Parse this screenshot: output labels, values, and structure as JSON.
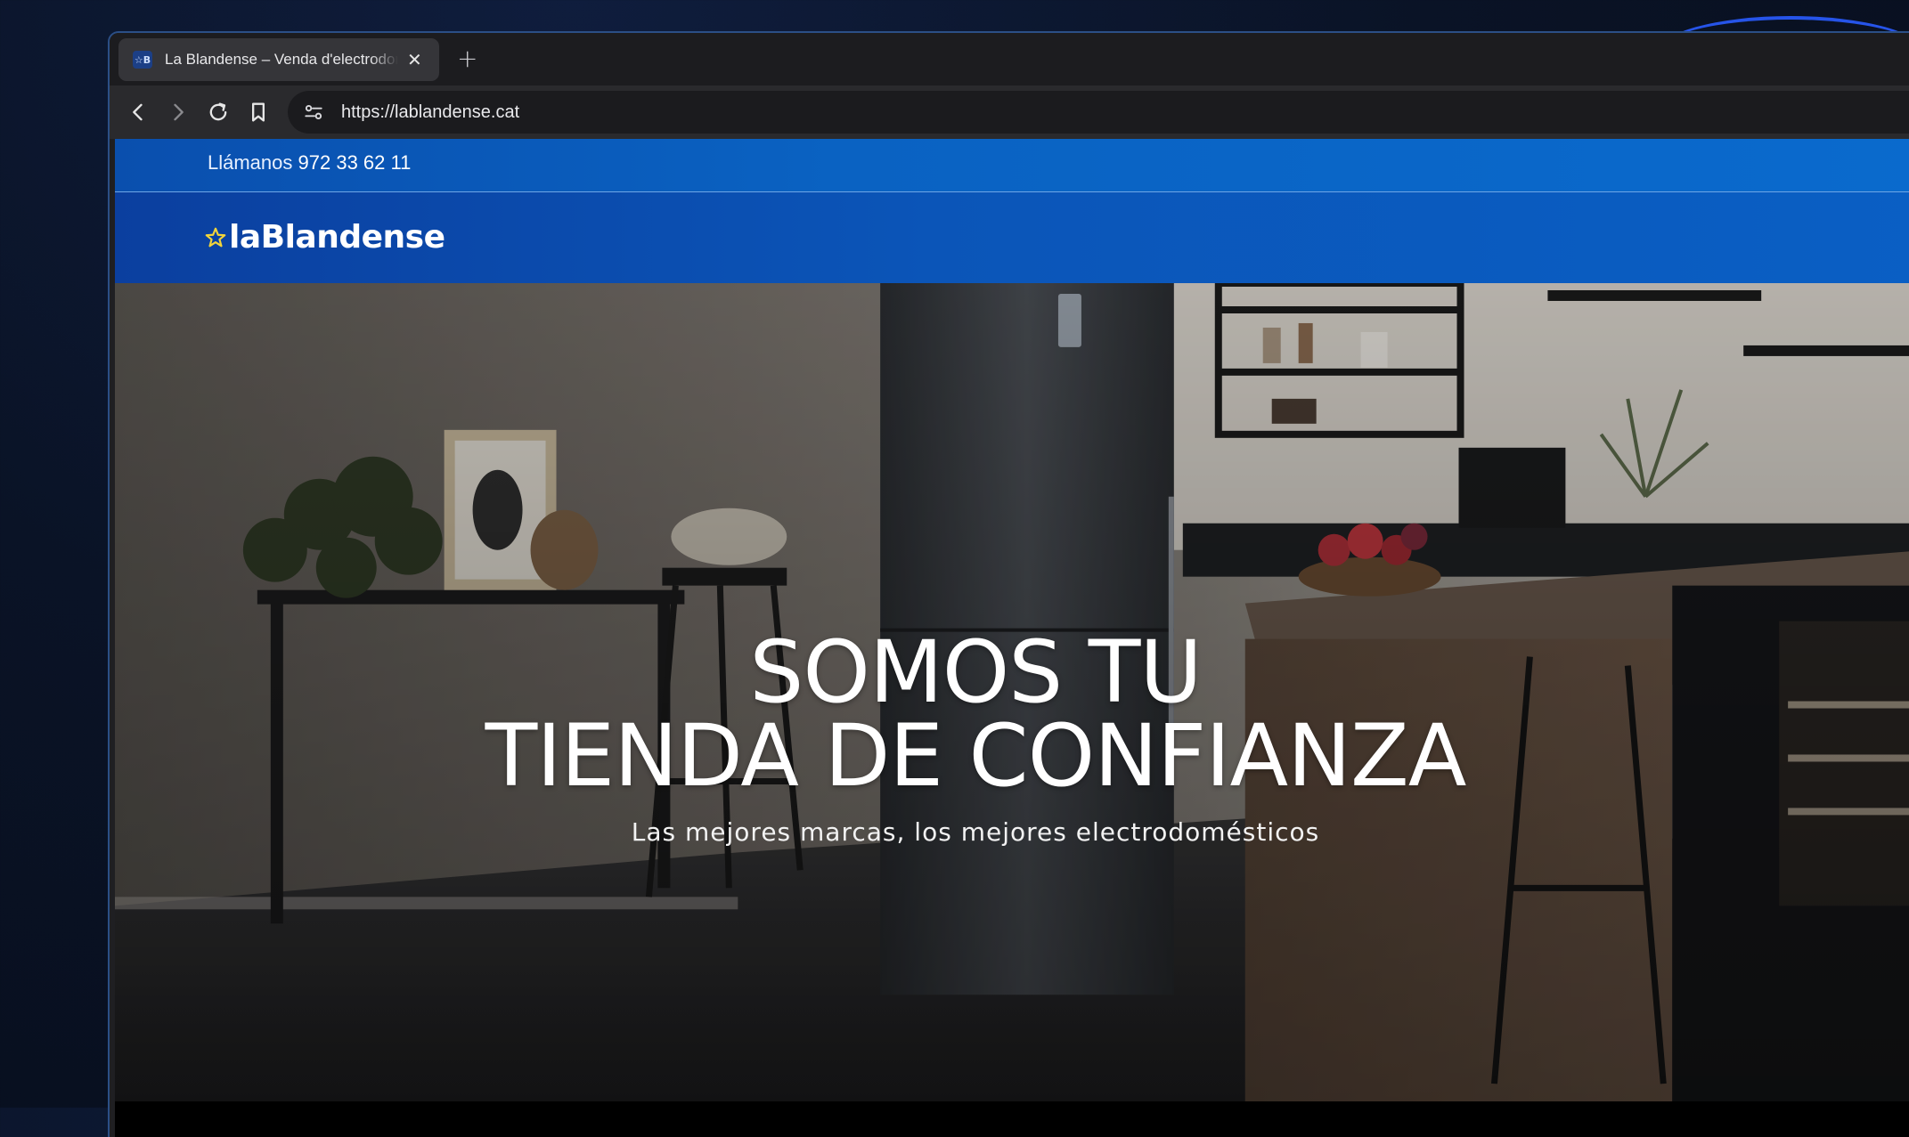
{
  "browser": {
    "tab": {
      "favicon_text": "☆B",
      "title": "La Blandense – Venda d'electrodomèstics",
      "close_label": "✕"
    },
    "new_tab_label": "+",
    "url": "https://lablandense.cat"
  },
  "site": {
    "topbar": {
      "call_label": "Llámanos",
      "phone": "972 33 62 11"
    },
    "logo": {
      "text": "laBlandense",
      "star_color": "#f2d43a"
    },
    "hero": {
      "title_line1": "SOMOS TU",
      "title_line2": "TIENDA DE CONFIANZA",
      "subtitle": "Las mejores marcas, los mejores electrodomésticos"
    }
  },
  "colors": {
    "brand_blue": "#0a5fc4",
    "dark_navy": "#0b3f9f"
  }
}
